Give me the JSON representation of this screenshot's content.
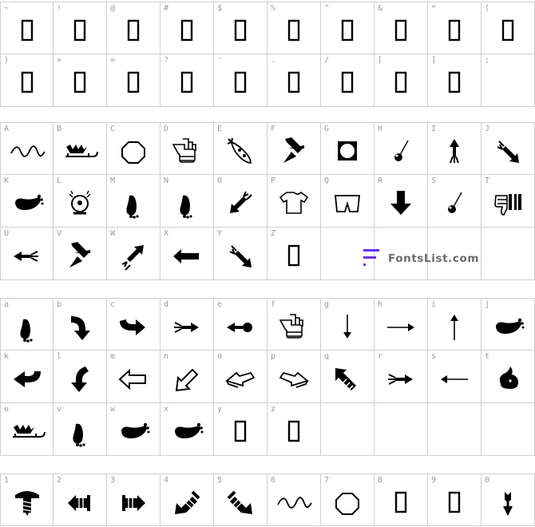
{
  "sections": [
    {
      "id": "symbols",
      "rows": [
        [
          {
            "label": "~",
            "glyph": "box"
          },
          {
            "label": "!",
            "glyph": "box"
          },
          {
            "label": "@",
            "glyph": "box"
          },
          {
            "label": "#",
            "glyph": "box"
          },
          {
            "label": "$",
            "glyph": "box"
          },
          {
            "label": "%",
            "glyph": "box"
          },
          {
            "label": "^",
            "glyph": "box"
          },
          {
            "label": "&",
            "glyph": "box"
          },
          {
            "label": "*",
            "glyph": "box"
          },
          {
            "label": "(",
            "glyph": "box"
          }
        ],
        [
          {
            "label": ")",
            "glyph": "box"
          },
          {
            "label": "+",
            "glyph": "box"
          },
          {
            "label": "=",
            "glyph": "box"
          },
          {
            "label": "?",
            "glyph": "box"
          },
          {
            "label": "'",
            "glyph": "box"
          },
          {
            "label": ".",
            "glyph": "box"
          },
          {
            "label": "/",
            "glyph": "box"
          },
          {
            "label": "[",
            "glyph": "box"
          },
          {
            "label": "]",
            "glyph": "box"
          },
          {
            "label": ";",
            "glyph": "none"
          }
        ]
      ]
    },
    {
      "id": "uppercase",
      "rows": [
        [
          {
            "label": "A",
            "glyph": "squiggle"
          },
          {
            "label": "B",
            "glyph": "sled"
          },
          {
            "label": "C",
            "glyph": "octagon"
          },
          {
            "label": "D",
            "glyph": "hand-point"
          },
          {
            "label": "E",
            "glyph": "rocket"
          },
          {
            "label": "F",
            "glyph": "arrow-thick-down-right"
          },
          {
            "label": "G",
            "glyph": "moon-square"
          },
          {
            "label": "H",
            "glyph": "pin-dot"
          },
          {
            "label": "I",
            "glyph": "arrow-up-feather"
          },
          {
            "label": "J",
            "glyph": "arrow-down-right-feather"
          }
        ],
        [
          {
            "label": "K",
            "glyph": "foot-side"
          },
          {
            "label": "L",
            "glyph": "alarm-bell"
          },
          {
            "label": "M",
            "glyph": "footprint"
          },
          {
            "label": "N",
            "glyph": "footprint"
          },
          {
            "label": "O",
            "glyph": "arrow-down-left-feather"
          },
          {
            "label": "P",
            "glyph": "tshirt"
          },
          {
            "label": "Q",
            "glyph": "shorts"
          },
          {
            "label": "R",
            "glyph": "arrow-thick-down"
          },
          {
            "label": "S",
            "glyph": "pin-dot"
          },
          {
            "label": "T",
            "glyph": "thumbs-down"
          }
        ],
        [
          {
            "label": "U",
            "glyph": "arrow-left-feather"
          },
          {
            "label": "V",
            "glyph": "arrow-thick-down-right"
          },
          {
            "label": "W",
            "glyph": "arrow-up-right-feather"
          },
          {
            "label": "X",
            "glyph": "arrow-thick-left"
          },
          {
            "label": "Y",
            "glyph": "arrow-down-right-feather"
          },
          {
            "label": "Z",
            "glyph": "box"
          },
          {
            "label": "",
            "glyph": "none"
          },
          {
            "label": "",
            "glyph": "none"
          },
          {
            "label": "",
            "glyph": "none"
          },
          {
            "label": "",
            "glyph": "none"
          }
        ]
      ]
    },
    {
      "id": "lowercase",
      "rows": [
        [
          {
            "label": "a",
            "glyph": "footprint"
          },
          {
            "label": "b",
            "glyph": "arrow-curve-down"
          },
          {
            "label": "c",
            "glyph": "arrow-curve-right"
          },
          {
            "label": "d",
            "glyph": "arrow-right-feather"
          },
          {
            "label": "e",
            "glyph": "arrow-left-ball"
          },
          {
            "label": "f",
            "glyph": "hand-point"
          },
          {
            "label": "g",
            "glyph": "arrow-thin-down"
          },
          {
            "label": "h",
            "glyph": "arrow-thin-right"
          },
          {
            "label": "i",
            "glyph": "arrow-thin-up"
          },
          {
            "label": "j",
            "glyph": "foot-side"
          }
        ],
        [
          {
            "label": "k",
            "glyph": "arrow-curve-left"
          },
          {
            "label": "l",
            "glyph": "arrow-curve-down-left"
          },
          {
            "label": "m",
            "glyph": "arrow-outline-left"
          },
          {
            "label": "n",
            "glyph": "arrow-outline-down-left"
          },
          {
            "label": "o",
            "glyph": "arrow-outline-3d"
          },
          {
            "label": "p",
            "glyph": "arrow-outline-3d-right"
          },
          {
            "label": "q",
            "glyph": "arrow-striped-up-left"
          },
          {
            "label": "r",
            "glyph": "arrow-right-feather"
          },
          {
            "label": "s",
            "glyph": "arrow-thin-left"
          },
          {
            "label": "t",
            "glyph": "squirrel"
          }
        ],
        [
          {
            "label": "u",
            "glyph": "sled"
          },
          {
            "label": "v",
            "glyph": "footprint"
          },
          {
            "label": "w",
            "glyph": "foot-side"
          },
          {
            "label": "x",
            "glyph": "foot-side"
          },
          {
            "label": "y",
            "glyph": "box"
          },
          {
            "label": "z",
            "glyph": "box"
          },
          {
            "label": "",
            "glyph": "none"
          },
          {
            "label": "",
            "glyph": "none"
          },
          {
            "label": "",
            "glyph": "none"
          },
          {
            "label": "",
            "glyph": "none"
          }
        ]
      ]
    },
    {
      "id": "digits",
      "rows": [
        [
          {
            "label": "1",
            "glyph": "screw"
          },
          {
            "label": "2",
            "glyph": "arrow-screw-left"
          },
          {
            "label": "3",
            "glyph": "arrow-screw-right"
          },
          {
            "label": "4",
            "glyph": "arrow-screw-down-left"
          },
          {
            "label": "5",
            "glyph": "arrow-screw-down-right"
          },
          {
            "label": "6",
            "glyph": "squiggle"
          },
          {
            "label": "7",
            "glyph": "octagon"
          },
          {
            "label": "8",
            "glyph": "box"
          },
          {
            "label": "9",
            "glyph": "box"
          },
          {
            "label": "0",
            "glyph": "arrow-down-small"
          }
        ]
      ]
    }
  ],
  "watermark": {
    "text": "FontsList.com",
    "color": "#6a2ff0",
    "icon": "fontslist-logo-icon"
  }
}
